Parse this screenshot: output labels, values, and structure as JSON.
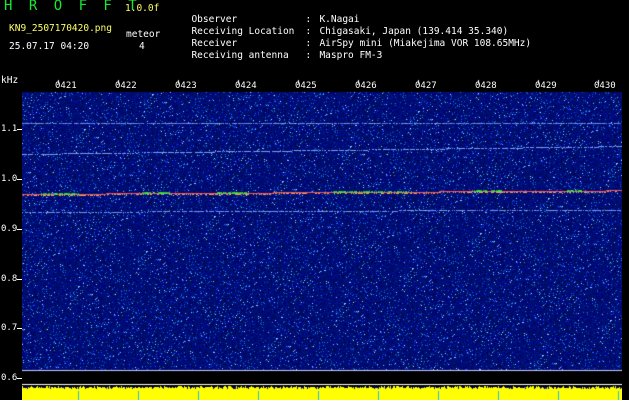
{
  "header": {
    "app_title": "H R O F F T",
    "version": "1.0.0f",
    "filename": "KN9_2507170420.png",
    "meteor_label": "meteor",
    "meteor_count": "4",
    "datetime": "25.07.17 04:20"
  },
  "info": [
    {
      "label": "Observer",
      "value": "K.Nagai"
    },
    {
      "label": "Receiving Location",
      "value": "Chigasaki, Japan (139.414 35.340)"
    },
    {
      "label": "Receiver",
      "value": "AirSpy mini (Miakejima VOR 108.65MHz)"
    },
    {
      "label": "Receiving antenna",
      "value": "Maspro FM-3"
    }
  ],
  "axis": {
    "y_unit": "kHz",
    "y_ticks": [
      "1.1",
      "1.0",
      "0.9",
      "0.8",
      "0.7",
      "0.6"
    ],
    "x_ticks": [
      "0421",
      "0422",
      "0423",
      "0424",
      "0425",
      "0426",
      "0427",
      "0428",
      "0429",
      "0430"
    ]
  },
  "colors": {
    "background": "#000000",
    "noise_base": "#00007a",
    "signal_line": "#8fb6ff",
    "carrier_line": "#ff5a5a",
    "echo_green": "#33ff33",
    "baseline_fill": "#ffff00",
    "text_accent": "#19e832"
  }
}
